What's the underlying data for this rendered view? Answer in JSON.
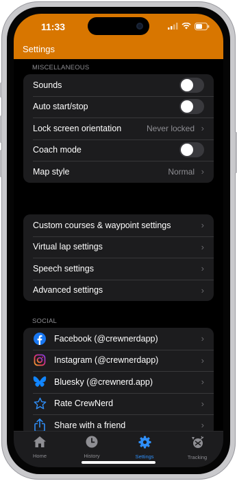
{
  "status_bar": {
    "time": "11:33"
  },
  "header": {
    "title": "Settings"
  },
  "sections": {
    "misc": {
      "label": "MISCELLANEOUS",
      "rows": [
        {
          "label": "Sounds",
          "toggle": false
        },
        {
          "label": "Auto start/stop",
          "toggle": false
        },
        {
          "label": "Lock screen orientation",
          "value": "Never locked"
        },
        {
          "label": "Coach mode",
          "toggle": false
        },
        {
          "label": "Map style",
          "value": "Normal"
        }
      ]
    },
    "settings": {
      "rows": [
        {
          "label": "Custom courses & waypoint settings"
        },
        {
          "label": "Virtual lap settings"
        },
        {
          "label": "Speech settings"
        },
        {
          "label": "Advanced settings"
        }
      ]
    },
    "social": {
      "label": "SOCIAL",
      "rows": [
        {
          "label": "Facebook (@crewnerdapp)",
          "icon": "facebook-icon"
        },
        {
          "label": "Instagram (@crewnerdapp)",
          "icon": "instagram-icon"
        },
        {
          "label": "Bluesky (@crewnerd.app)",
          "icon": "bluesky-icon"
        },
        {
          "label": "Rate CrewNerd",
          "icon": "star-icon"
        },
        {
          "label": "Share with a friend",
          "icon": "share-icon"
        }
      ]
    }
  },
  "tabbar": {
    "tabs": [
      {
        "label": "Home",
        "icon": "home-icon",
        "active": false
      },
      {
        "label": "History",
        "icon": "clock-icon",
        "active": false
      },
      {
        "label": "Settings",
        "icon": "gear-icon",
        "active": true
      },
      {
        "label": "Tracking",
        "icon": "tracking-icon",
        "active": false
      }
    ]
  },
  "colors": {
    "header": "#d87600",
    "accent": "#2f8ef7",
    "group_bg": "#1c1c1e",
    "facebook": "#1877f2",
    "bluesky": "#1185fe"
  }
}
